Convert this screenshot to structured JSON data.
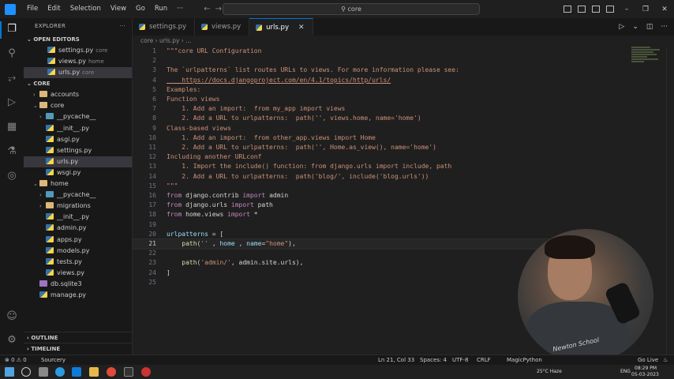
{
  "menu": [
    "File",
    "Edit",
    "Selection",
    "View",
    "Go",
    "Run",
    "···"
  ],
  "search": {
    "text": "core"
  },
  "sidebar": {
    "title": "EXPLORER",
    "open_editors_label": "OPEN EDITORS",
    "open_editors": [
      {
        "name": "settings.py",
        "desc": "core"
      },
      {
        "name": "views.py",
        "desc": "home"
      },
      {
        "name": "urls.py",
        "desc": "core"
      }
    ],
    "project_label": "CORE",
    "tree": [
      {
        "name": "accounts",
        "kind": "folder",
        "depth": 1,
        "arrow": "›"
      },
      {
        "name": "core",
        "kind": "folder",
        "depth": 1,
        "arrow": "⌄"
      },
      {
        "name": "__pycache__",
        "kind": "folder-blue",
        "depth": 2,
        "arrow": "›"
      },
      {
        "name": "__init__.py",
        "kind": "py",
        "depth": 2,
        "arrow": ""
      },
      {
        "name": "asgi.py",
        "kind": "py",
        "depth": 2,
        "arrow": ""
      },
      {
        "name": "settings.py",
        "kind": "py",
        "depth": 2,
        "arrow": ""
      },
      {
        "name": "urls.py",
        "kind": "py",
        "depth": 2,
        "arrow": "",
        "selected": true
      },
      {
        "name": "wsgi.py",
        "kind": "py",
        "depth": 2,
        "arrow": ""
      },
      {
        "name": "home",
        "kind": "folder",
        "depth": 1,
        "arrow": "⌄"
      },
      {
        "name": "__pycache__",
        "kind": "folder-blue",
        "depth": 2,
        "arrow": "›"
      },
      {
        "name": "migrations",
        "kind": "folder",
        "depth": 2,
        "arrow": "›"
      },
      {
        "name": "__init__.py",
        "kind": "py",
        "depth": 2,
        "arrow": ""
      },
      {
        "name": "admin.py",
        "kind": "py",
        "depth": 2,
        "arrow": ""
      },
      {
        "name": "apps.py",
        "kind": "py",
        "depth": 2,
        "arrow": ""
      },
      {
        "name": "models.py",
        "kind": "py",
        "depth": 2,
        "arrow": ""
      },
      {
        "name": "tests.py",
        "kind": "py",
        "depth": 2,
        "arrow": ""
      },
      {
        "name": "views.py",
        "kind": "py",
        "depth": 2,
        "arrow": ""
      },
      {
        "name": "db.sqlite3",
        "kind": "db",
        "depth": 1,
        "arrow": ""
      },
      {
        "name": "manage.py",
        "kind": "py",
        "depth": 1,
        "arrow": ""
      }
    ],
    "outline_label": "OUTLINE",
    "timeline_label": "TIMELINE"
  },
  "tabs": [
    {
      "label": "settings.py",
      "active": false
    },
    {
      "label": "views.py",
      "active": false
    },
    {
      "label": "urls.py",
      "active": true
    }
  ],
  "breadcrumb": "core  ›  urls.py  ›  ...",
  "editor": {
    "current_line": 21,
    "lines": [
      [
        [
          "c-str",
          "\"\"\"core URL Configuration"
        ]
      ],
      [],
      [
        [
          "c-str",
          "The `urlpatterns` list routes URLs to views. For more information please see:"
        ]
      ],
      [
        [
          "c-link",
          "    https://docs.djangoproject.com/en/4.1/topics/http/urls/"
        ]
      ],
      [
        [
          "c-str",
          "Examples:"
        ]
      ],
      [
        [
          "c-str",
          "Function views"
        ]
      ],
      [
        [
          "c-str",
          "    1. Add an import:  from my_app import views"
        ]
      ],
      [
        [
          "c-str",
          "    2. Add a URL to urlpatterns:  path('', views.home, name='home')"
        ]
      ],
      [
        [
          "c-str",
          "Class-based views"
        ]
      ],
      [
        [
          "c-str",
          "    1. Add an import:  from other_app.views import Home"
        ]
      ],
      [
        [
          "c-str",
          "    2. Add a URL to urlpatterns:  path('', Home.as_view(), name='home')"
        ]
      ],
      [
        [
          "c-str",
          "Including another URLconf"
        ]
      ],
      [
        [
          "c-str",
          "    1. Import the include() function: from django.urls import include, path"
        ]
      ],
      [
        [
          "c-str",
          "    2. Add a URL to urlpatterns:  path('blog/', include('blog.urls'))"
        ]
      ],
      [
        [
          "c-str",
          "\"\"\""
        ]
      ],
      [
        [
          "c-kw",
          "from "
        ],
        [
          "c-def",
          "django.contrib "
        ],
        [
          "c-kw",
          "import "
        ],
        [
          "c-def",
          "admin"
        ]
      ],
      [
        [
          "c-kw",
          "from "
        ],
        [
          "c-def",
          "django.urls "
        ],
        [
          "c-kw",
          "import "
        ],
        [
          "c-def",
          "path"
        ]
      ],
      [
        [
          "c-kw",
          "from "
        ],
        [
          "c-def",
          "home.views "
        ],
        [
          "c-kw",
          "import "
        ],
        [
          "c-def",
          "*"
        ]
      ],
      [],
      [
        [
          "c-var",
          "urlpatterns "
        ],
        [
          "c-def",
          "= ["
        ]
      ],
      [
        [
          "c-fn",
          "    path"
        ],
        [
          "c-def",
          "("
        ],
        [
          "c-str",
          "''"
        ],
        [
          "c-def",
          " , "
        ],
        [
          "c-var",
          "home"
        ],
        [
          "c-def",
          " , "
        ],
        [
          "c-var",
          "name"
        ],
        [
          "c-def",
          "="
        ],
        [
          "c-str",
          "\"home\""
        ],
        [
          "c-def",
          "),"
        ]
      ],
      [],
      [
        [
          "c-fn",
          "    path"
        ],
        [
          "c-def",
          "("
        ],
        [
          "c-str",
          "'admin/'"
        ],
        [
          "c-def",
          ", admin.site.urls),"
        ]
      ],
      [
        [
          "c-def",
          "]"
        ]
      ],
      []
    ]
  },
  "status": {
    "errors": "⊗ 0 ⚠ 0",
    "sourcery": "Sourcery",
    "position": "Ln 21, Col 33",
    "spaces": "Spaces: 4",
    "encoding": "UTF-8",
    "eol": "CRLF",
    "language": "MagicPython",
    "golive": "Go Live"
  },
  "webcam": {
    "text": "Newton School"
  },
  "taskbar": {
    "weather": "25°C Haze",
    "lang": "ENG",
    "time": "08:29 PM",
    "date": "05-03-2023"
  }
}
